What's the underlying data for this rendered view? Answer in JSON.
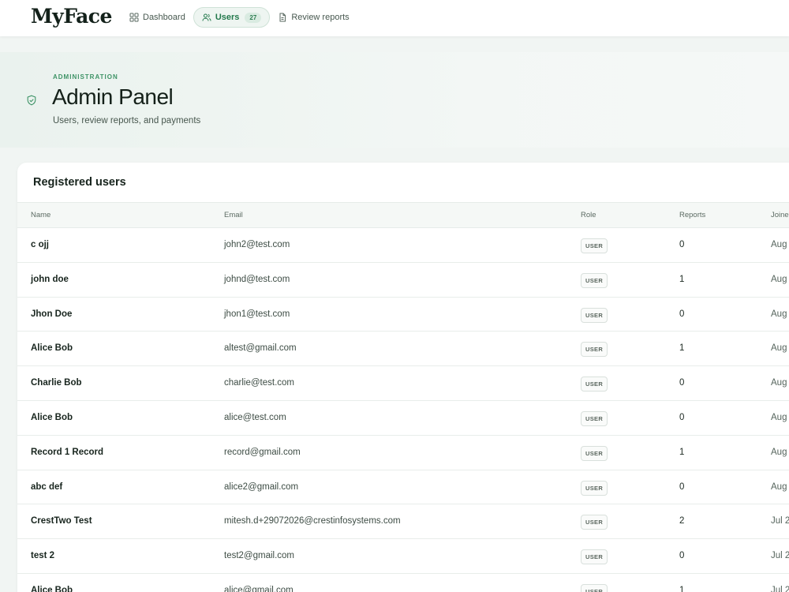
{
  "app": {
    "logo": "MyFace"
  },
  "nav": {
    "items": [
      {
        "label": "Dashboard",
        "icon": "grid-icon",
        "active": false
      },
      {
        "label": "Users",
        "icon": "users-icon",
        "active": true,
        "badge": "27"
      },
      {
        "label": "Review reports",
        "icon": "document-icon",
        "active": false
      }
    ]
  },
  "header": {
    "eyebrow": "ADMINISTRATION",
    "title": "Admin Panel",
    "subtitle": "Users, review reports, and payments",
    "icon": "shield-check-icon"
  },
  "users_table": {
    "title": "Registered users",
    "columns": [
      "Name",
      "Email",
      "Role",
      "Reports",
      "Joined"
    ],
    "rows": [
      {
        "name": "c ojj",
        "email": "john2@test.com",
        "role": "USER",
        "reports": "0",
        "joined": "Aug"
      },
      {
        "name": "john doe",
        "email": "johnd@test.com",
        "role": "USER",
        "reports": "1",
        "joined": "Aug"
      },
      {
        "name": "Jhon Doe",
        "email": "jhon1@test.com",
        "role": "USER",
        "reports": "0",
        "joined": "Aug"
      },
      {
        "name": "Alice Bob",
        "email": "altest@gmail.com",
        "role": "USER",
        "reports": "1",
        "joined": "Aug"
      },
      {
        "name": "Charlie Bob",
        "email": "charlie@test.com",
        "role": "USER",
        "reports": "0",
        "joined": "Aug"
      },
      {
        "name": "Alice Bob",
        "email": "alice@test.com",
        "role": "USER",
        "reports": "0",
        "joined": "Aug"
      },
      {
        "name": "Record 1 Record",
        "email": "record@gmail.com",
        "role": "USER",
        "reports": "1",
        "joined": "Aug"
      },
      {
        "name": "abc def",
        "email": "alice2@gmail.com",
        "role": "USER",
        "reports": "0",
        "joined": "Aug"
      },
      {
        "name": "CrestTwo Test",
        "email": "mitesh.d+29072026@crestinfosystems.com",
        "role": "USER",
        "reports": "2",
        "joined": "Jul 2"
      },
      {
        "name": "test 2",
        "email": "test2@gmail.com",
        "role": "USER",
        "reports": "0",
        "joined": "Jul 2"
      },
      {
        "name": "Alice Bob",
        "email": "alice@gmail.com",
        "role": "USER",
        "reports": "1",
        "joined": "Jul 2"
      }
    ]
  },
  "colors": {
    "accent": "#23794c",
    "background": "#f1f5f3"
  }
}
